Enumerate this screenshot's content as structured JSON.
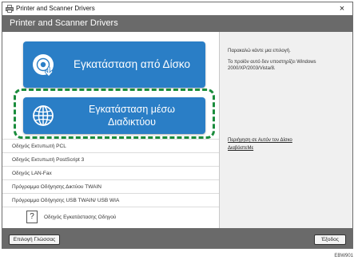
{
  "window": {
    "title": "Printer and Scanner Drivers",
    "close_glyph": "×",
    "header": "Printer and Scanner Drivers"
  },
  "buttons": {
    "install_disk": {
      "label": "Εγκατάσταση από Δίσκο",
      "icon": "disc-install-icon"
    },
    "install_net": {
      "line1": "Εγκατάσταση μέσω",
      "line2": "Διαδικτύου",
      "icon": "globe-icon"
    }
  },
  "highlight": {
    "color": "#1a8c3c"
  },
  "driver_list": [
    "Οδηγός Εκτυπωτή PCL",
    "Οδηγός Εκτυπωτή PostScript 3",
    "Οδηγός LAN-Fax",
    "Πρόγραμμα Οδήγησης Δικτύου TWAIN",
    "Πρόγραμμα Οδήγησης USB TWAIN/ USB WIA"
  ],
  "guide": {
    "icon_glyph": "?",
    "label": "Οδηγός Εγκατάστασης Οδηγού"
  },
  "right_panel": {
    "prompt": "Παρακαλώ κάντε μια επιλογή.",
    "note": "Το προϊόν αυτό δεν υποστηρίζει Windows 2000/XP/2003/Vista/8.",
    "link_about": "Περιήγηση σε Αυτόν τον Δίσκο",
    "link_readme": "ΔιαβάστεΜε"
  },
  "footer": {
    "language_button": "Επιλογή Γλώσσας",
    "exit_button": "Έξοδος"
  },
  "reference_code": "EBW901",
  "colors": {
    "accent_blue": "#2a7ec6",
    "header_gray": "#6a6a6a"
  }
}
